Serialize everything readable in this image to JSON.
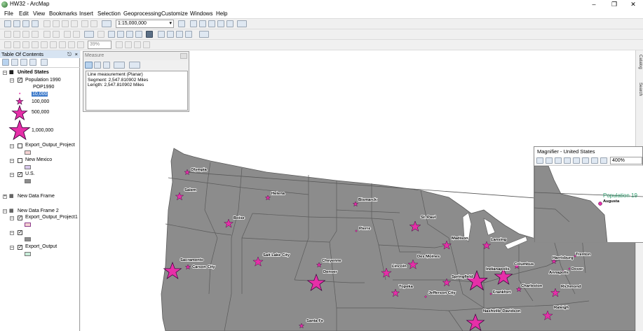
{
  "window": {
    "title": "HW32 - ArcMap"
  },
  "menu": [
    "File",
    "Edit",
    "View",
    "Bookmarks",
    "Insert",
    "Selection",
    "Geoprocessing",
    "Customize",
    "Windows",
    "Help"
  ],
  "toolbar": {
    "scale": "1:15,000,000",
    "zoom": "39%"
  },
  "toc": {
    "title": "Table Of Contents",
    "group1": "United States",
    "layer_population": "Population 1990",
    "field": "POP1990",
    "legend": [
      "10,000",
      "100,000",
      "500,000",
      "1,000,000"
    ],
    "layer_export": "Export_Output_Project",
    "layer_nm": "New Mexico",
    "layer_us": "U.S.",
    "group2": "New Data Frame",
    "group3": "New Data Frame 2",
    "layer_export1": "Export_Output_Project1",
    "layer_export_out": "Export_Output",
    "swatch_colors": {
      "pink": "#f5d3d3",
      "lavender": "#d9c8ec",
      "gray": "#8c8c8c",
      "mint": "#c8ecd9"
    }
  },
  "measure": {
    "title": "Measure",
    "line1": "Line measurement (Planar)",
    "line2": "Segment: 2,547.810902 Miles",
    "line3": "Length: 2,547.810902 Miles"
  },
  "magnifier": {
    "title": "Magnifier - United States",
    "zoom": "400%",
    "overlay_text": "Population 19",
    "city": "Augusta"
  },
  "side_tabs": [
    "Catalog",
    "Search"
  ],
  "map": {
    "colors": {
      "land": "#8c8c8c",
      "border": "#5a5a5a",
      "symbol": "#e62fa8",
      "symbol_outline": "#3a003a"
    },
    "cities": [
      "Olympia",
      "Salem",
      "Helena",
      "Boise",
      "Bismarck",
      "Pierre",
      "St. Paul",
      "Madison",
      "Lansing",
      "Des Moines",
      "Salt Lake City",
      "Cheyenne",
      "Sacramento",
      "Carson City",
      "Denver",
      "Lincoln",
      "Springfield",
      "Indianapolis",
      "Columbus",
      "Harrisburg",
      "Trenton",
      "Dover",
      "Annapolis",
      "Richmond",
      "Charleston",
      "Frankfort",
      "Topeka",
      "Jefferson City",
      "Nashville-Davidson",
      "Raleigh",
      "Santa Fe"
    ]
  }
}
